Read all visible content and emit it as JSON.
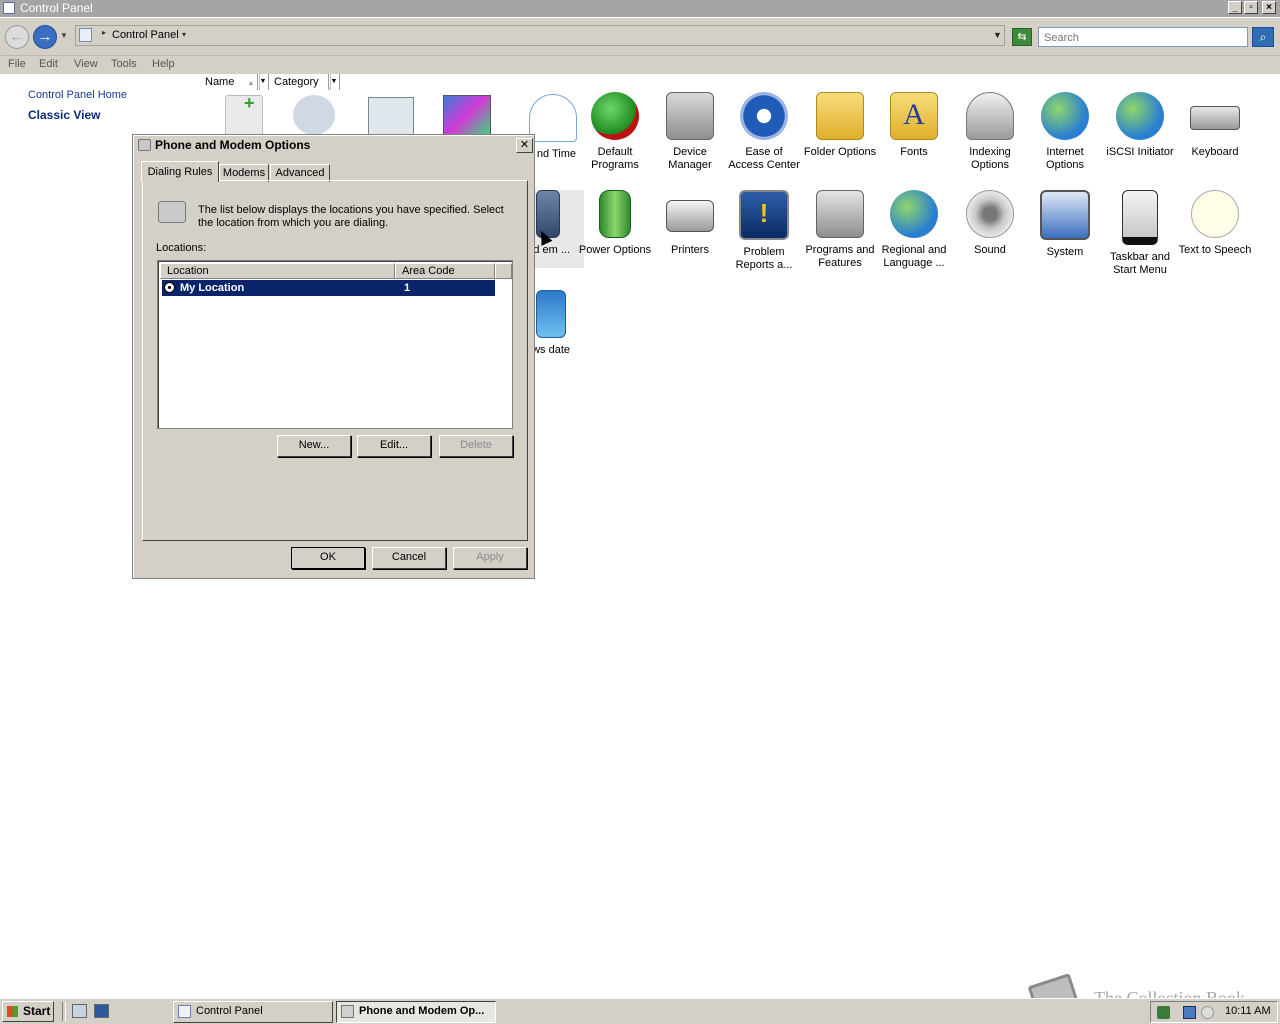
{
  "window": {
    "title": "Control Panel"
  },
  "address": {
    "path": "Control Panel",
    "search_placeholder": "Search"
  },
  "menu": [
    "File",
    "Edit",
    "View",
    "Tools",
    "Help"
  ],
  "nav": {
    "home": "Control Panel Home",
    "classic": "Classic View"
  },
  "columns": {
    "name": "Name",
    "category": "Category"
  },
  "icons": [
    {
      "label": "nd Time"
    },
    {
      "label": "Default Programs"
    },
    {
      "label": "Device Manager"
    },
    {
      "label": "Ease of Access Center"
    },
    {
      "label": "Folder Options"
    },
    {
      "label": "Fonts"
    },
    {
      "label": "Indexing Options"
    },
    {
      "label": "Internet Options"
    },
    {
      "label": "iSCSI Initiator"
    },
    {
      "label": "Keyboard"
    },
    {
      "label": "e and em ..."
    },
    {
      "label": "Power Options"
    },
    {
      "label": "Printers"
    },
    {
      "label": "Problem Reports a..."
    },
    {
      "label": "Programs and Features"
    },
    {
      "label": "Regional and Language ..."
    },
    {
      "label": "Sound"
    },
    {
      "label": "System"
    },
    {
      "label": "Taskbar and Start Menu"
    },
    {
      "label": "Text to Speech"
    },
    {
      "label": "dows date"
    }
  ],
  "dialog": {
    "title": "Phone and Modem Options",
    "close": "✕",
    "tabs": [
      "Dialing Rules",
      "Modems",
      "Advanced"
    ],
    "description": "The list below displays the locations you have specified. Select the location from which you are dialing.",
    "locations_label": "Locations:",
    "list_headers": {
      "location": "Location",
      "area_code": "Area Code"
    },
    "rows": [
      {
        "location": "My Location",
        "area_code": "1"
      }
    ],
    "buttons": {
      "new": "New...",
      "edit": "Edit...",
      "delete": "Delete",
      "ok": "OK",
      "cancel": "Cancel",
      "apply": "Apply"
    }
  },
  "taskbar": {
    "start": "Start",
    "tasks": [
      "Control Panel",
      "Phone and Modem Op..."
    ],
    "clock": "10:11 AM"
  },
  "watermark": "The Collection Book"
}
